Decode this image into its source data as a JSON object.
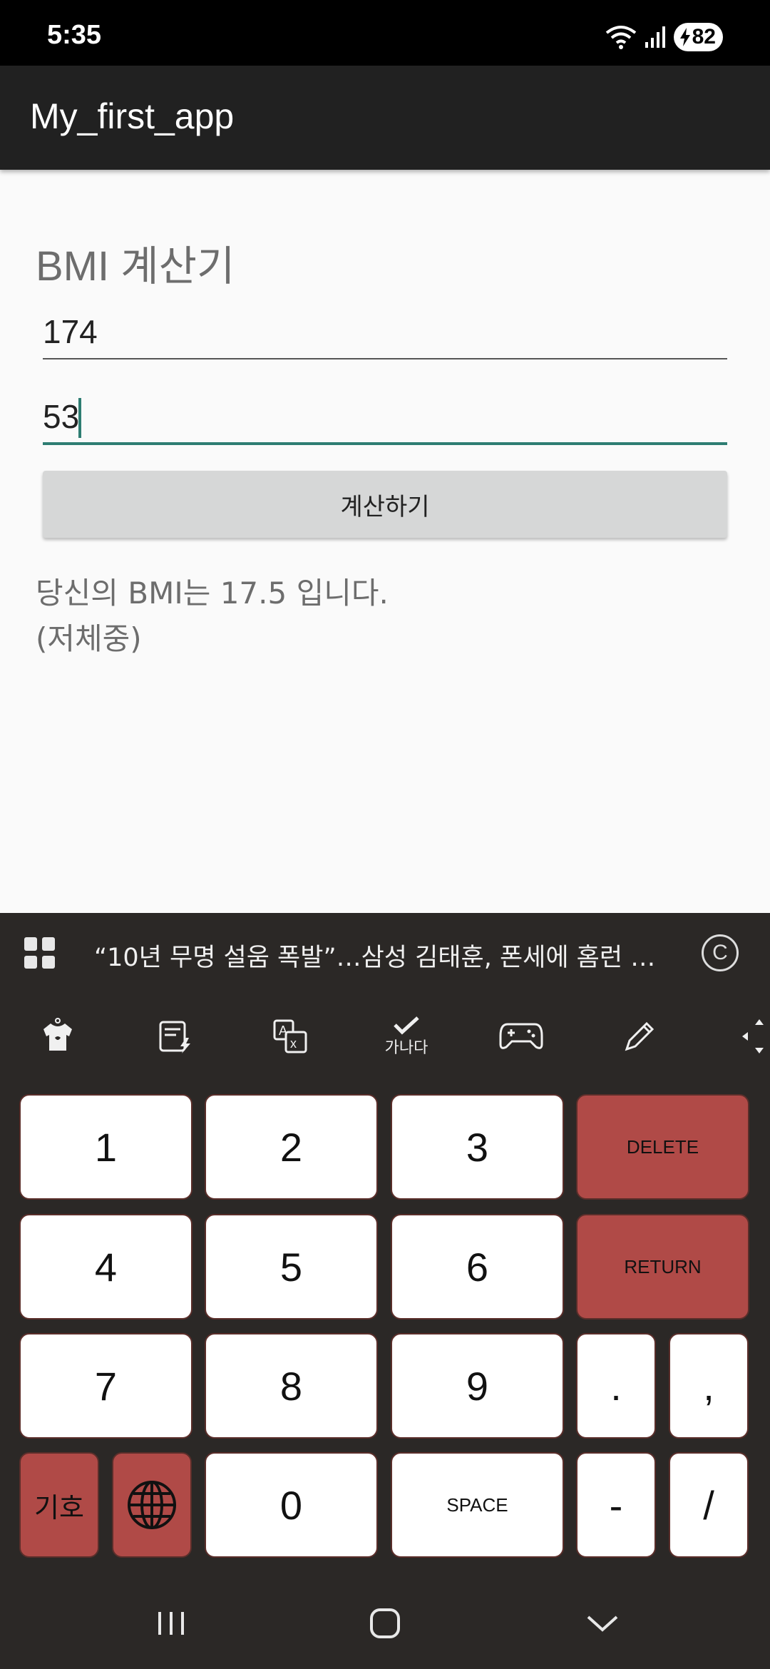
{
  "status": {
    "time": "5:35",
    "battery": "82"
  },
  "app": {
    "title": "My_first_app"
  },
  "form": {
    "heading": "BMI 계산기",
    "height_value": "174",
    "weight_value": "53",
    "calc_label": "계산하기",
    "result_line1": "당신의 BMI는 17.5 입니다.",
    "result_line2": "(저체중)"
  },
  "keyboard": {
    "news_headline": "“10년 무명 설움 폭발”…삼성 김태훈, 폰세에 홈런 …",
    "copyright": "C",
    "check_label": "가나다",
    "keys": {
      "k1": "1",
      "k2": "2",
      "k3": "3",
      "delete": "DELETE",
      "k4": "4",
      "k5": "5",
      "k6": "6",
      "return": "RETURN",
      "k7": "7",
      "k8": "8",
      "k9": "9",
      "period": ".",
      "comma": ",",
      "symbol": "기호",
      "k0": "0",
      "space": "SPACE",
      "dash": "-",
      "slash": "/"
    }
  }
}
